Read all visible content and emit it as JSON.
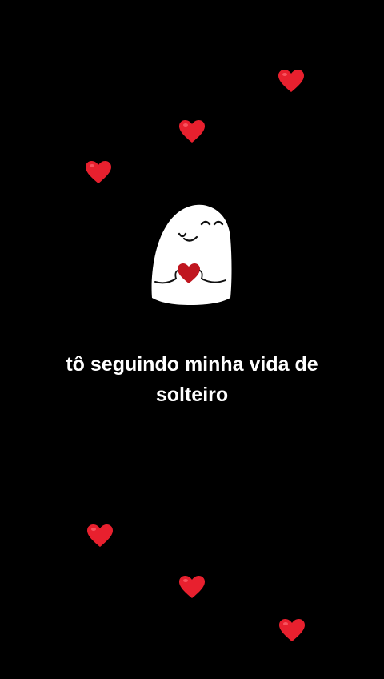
{
  "caption": {
    "line1": "tô seguindo minha vida de",
    "line2": "solteiro"
  },
  "colors": {
    "background": "#000000",
    "heart": "#e8202e",
    "text": "#ffffff"
  },
  "icons": {
    "hearts": "heart-icon",
    "character": "ghost-holding-heart-icon"
  }
}
